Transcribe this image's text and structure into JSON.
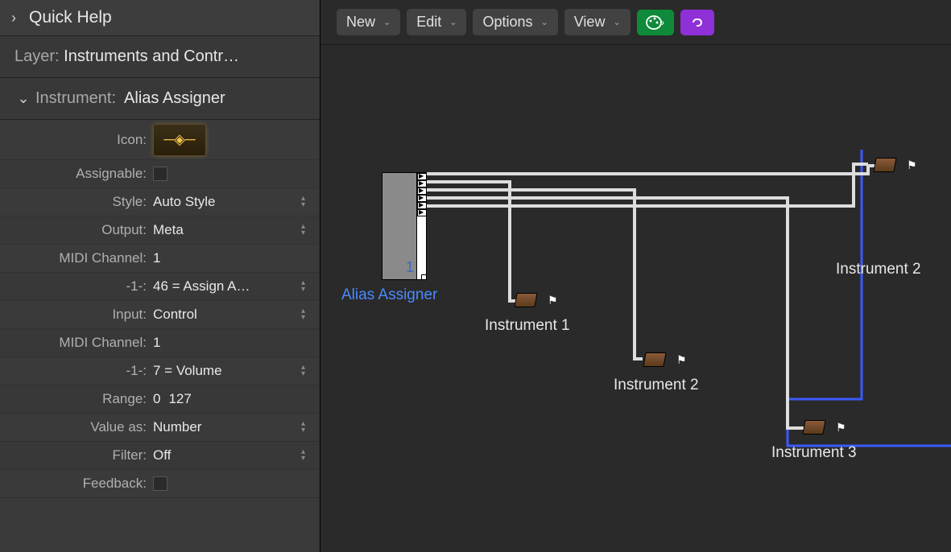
{
  "sidebar": {
    "quick_help": "Quick Help",
    "layer_label": "Layer:",
    "layer_value": "Instruments and Contr…",
    "instr_label": "Instrument:",
    "instr_value": "Alias Assigner",
    "props": {
      "icon_label": "Icon:",
      "assignable_label": "Assignable:",
      "style_label": "Style:",
      "style_value": "Auto Style",
      "output_label": "Output:",
      "output_value": "Meta",
      "midi1_label": "MIDI Channel:",
      "midi1_value": "1",
      "neg1a_label": "-1-:",
      "neg1a_value": "46 = Assign A…",
      "input_label": "Input:",
      "input_value": "Control",
      "midi2_label": "MIDI Channel:",
      "midi2_value": "1",
      "neg1b_label": "-1-:",
      "neg1b_value": "7 = Volume",
      "range_label": "Range:",
      "range_min": "0",
      "range_max": "127",
      "valueas_label": "Value as:",
      "valueas_value": "Number",
      "filter_label": "Filter:",
      "filter_value": "Off",
      "feedback_label": "Feedback:"
    }
  },
  "toolbar": {
    "new": "New",
    "edit": "Edit",
    "options": "Options",
    "view": "View"
  },
  "canvas": {
    "alias_label": "Alias Assigner",
    "alias_num": "1",
    "inst1": "Instrument 1",
    "inst2": "Instrument 2",
    "inst3": "Instrument 3",
    "inst2b": "Instrument 2"
  }
}
